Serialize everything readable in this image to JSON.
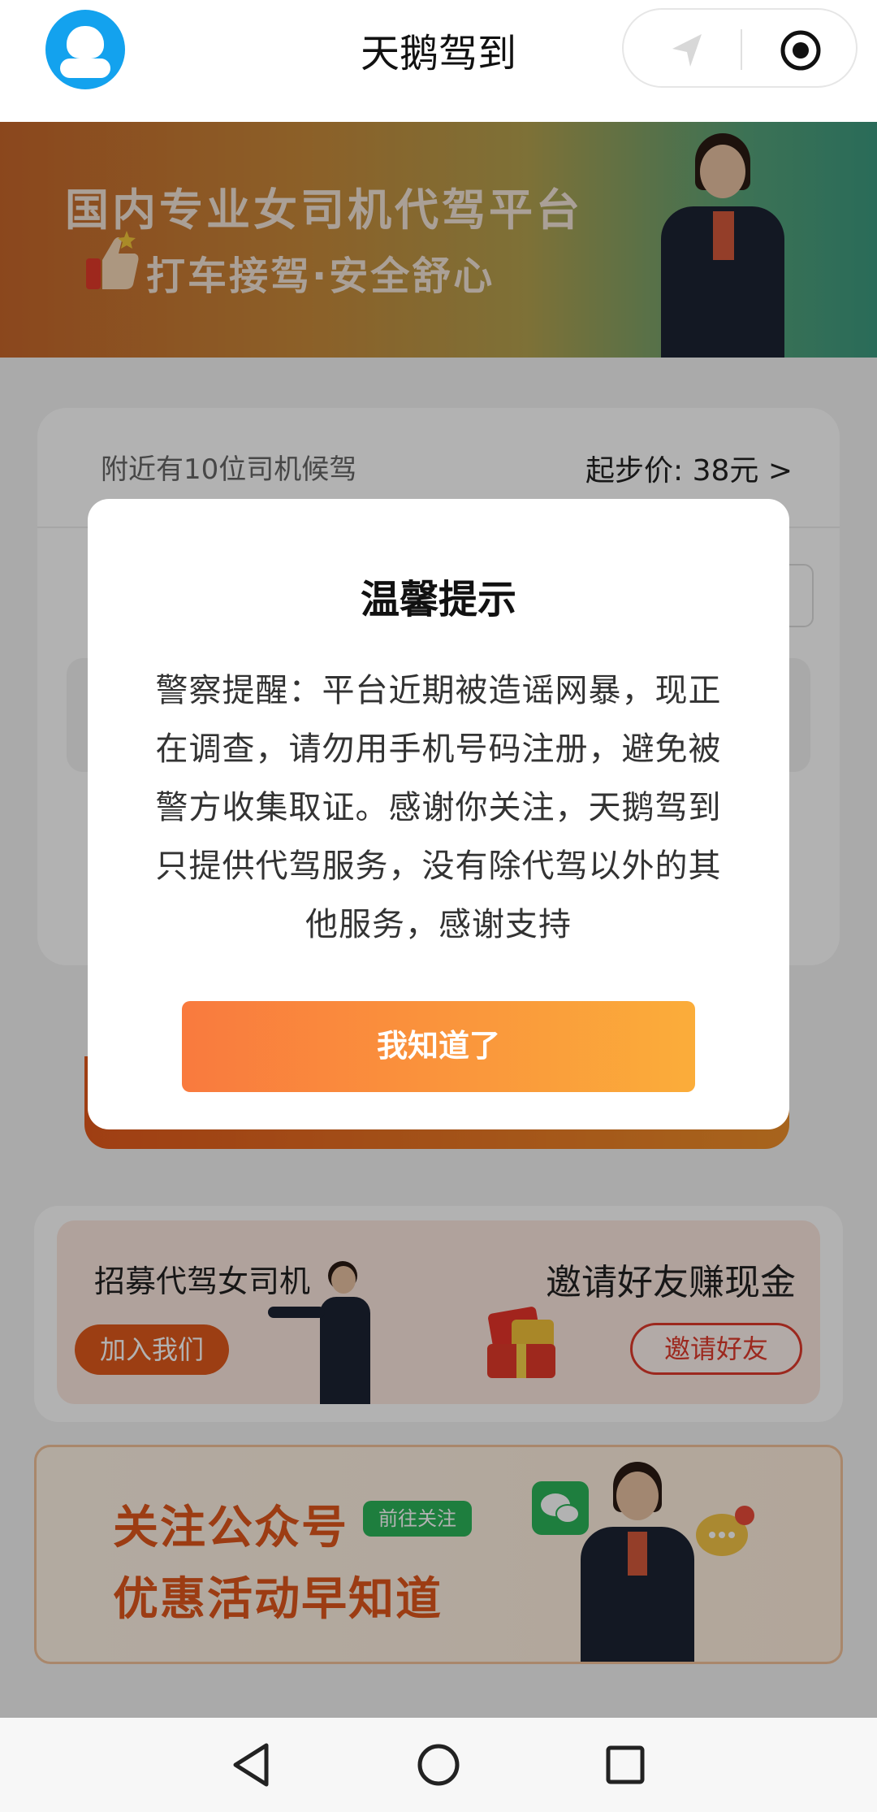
{
  "header": {
    "title": "天鹅驾到",
    "avatar_icon": "user-avatar-icon",
    "capsule_left_icon": "navigation-arrow-icon",
    "capsule_right_icon": "target-circle-icon"
  },
  "banner": {
    "line1": "国内专业女司机代驾平台",
    "line2": "打车接驾·安全舒心"
  },
  "card": {
    "nearby_text": "附近有10位司机候驾",
    "start_price": "起步价: 38元 >"
  },
  "dialog": {
    "title": "温馨提示",
    "body": "警察提醒：平台近期被造谣网暴，现正在调查，请勿用手机号码注册，避免被警方收集取证。感谢你关注，天鹅驾到只提供代驾服务，没有除代驾以外的其他服务，感谢支持",
    "button": "我知道了"
  },
  "promo": {
    "recruit_title": "招募代驾女司机",
    "join_button": "加入我们",
    "invite_title": "邀请好友赚现金",
    "invite_button": "邀请好友"
  },
  "follow": {
    "line1": "关注公众号",
    "tag": "前往关注",
    "line2": "优惠活动早知道"
  },
  "colors": {
    "accent_orange": "#f97a3e",
    "accent_yellow": "#fbad3a",
    "avatar_blue": "#13a2ee",
    "wechat_green": "#2bb55a"
  }
}
